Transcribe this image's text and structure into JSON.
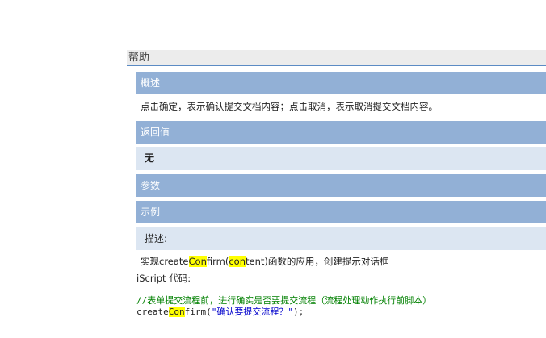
{
  "help": {
    "title": "帮助"
  },
  "overview": {
    "heading": "概述",
    "text": "点击确定，表示确认提交文档内容；点击取消，表示取消提交文档内容。"
  },
  "returns": {
    "heading": "返回值",
    "value": "无"
  },
  "params": {
    "heading": "参数"
  },
  "example": {
    "heading": "示例",
    "desc_label": "描述:",
    "desc_parts": [
      "实现create",
      "Con",
      "firm(",
      "con",
      "tent)函数的应用，创建提示对话框"
    ],
    "code_label": "iScript 代码:",
    "code_comment": "//表单提交流程前，进行确实是否要提交流程（流程处理动作执行前脚本）",
    "code_line_parts": [
      "create",
      "Con",
      "firm(",
      "\"确认要提交流程？\"",
      ");"
    ]
  },
  "colors": {
    "section_bar": "#92b0d6",
    "light_row": "#dce6f2",
    "highlight": "#ffff00",
    "accent": "#5b8bc4"
  }
}
